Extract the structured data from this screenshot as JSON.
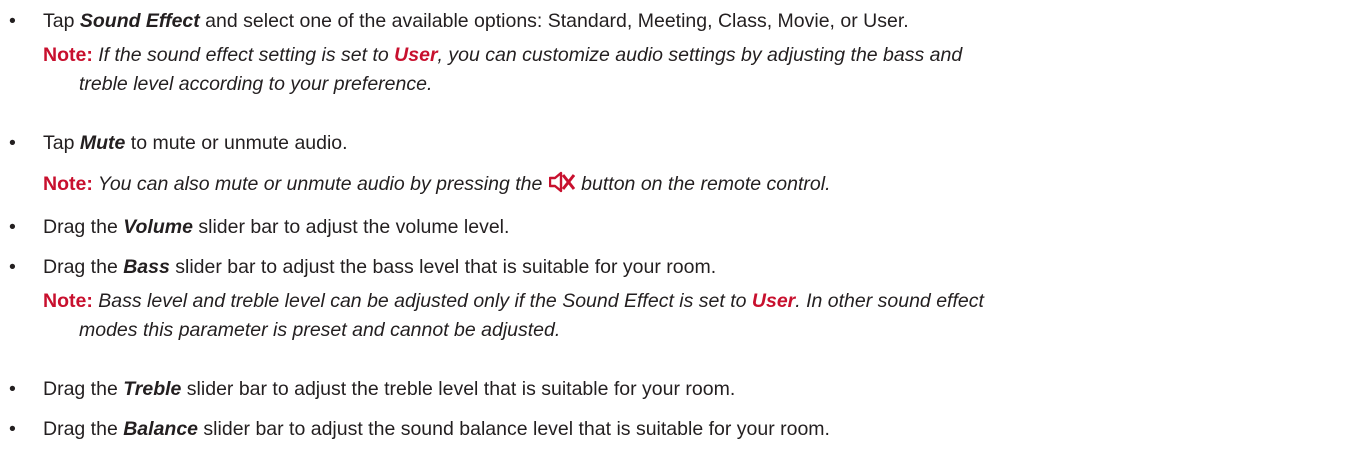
{
  "bullet_char": "•",
  "note_label": "Note:",
  "items": [
    {
      "pre": "Tap ",
      "em": "Sound Effect",
      "post": " and select one of the available options: Standard, Meeting, Class, Movie, or User.",
      "note": {
        "pre": " If the sound effect setting is set to ",
        "em": "User",
        "post": ", you can customize audio settings by adjusting the bass and",
        "cont": "treble level according to your preference."
      }
    },
    {
      "pre": "Tap ",
      "em": "Mute",
      "post": " to mute or unmute audio.",
      "note": {
        "pre": " You can also mute or unmute audio by pressing the ",
        "icon": "mute-speaker-icon",
        "post": " button on the remote control."
      }
    },
    {
      "pre": "Drag the ",
      "em": "Volume",
      "post": " slider bar to adjust the volume level."
    },
    {
      "pre": "Drag the ",
      "em": "Bass",
      "post": " slider bar to adjust the bass level that is suitable for your room.",
      "note": {
        "pre": " Bass level and treble level can be adjusted only if the Sound Effect is set to ",
        "em": "User",
        "post": ". In other sound effect",
        "cont": "modes this parameter is preset and cannot be adjusted."
      }
    },
    {
      "pre": "Drag the ",
      "em": "Treble",
      "post": " slider bar to adjust the treble level that is suitable for your room."
    },
    {
      "pre": "Drag the ",
      "em": "Balance",
      "post": " slider bar to adjust the sound balance level that is suitable for your room."
    }
  ],
  "colors": {
    "text": "#231f20",
    "note_accent": "#c8102e"
  }
}
